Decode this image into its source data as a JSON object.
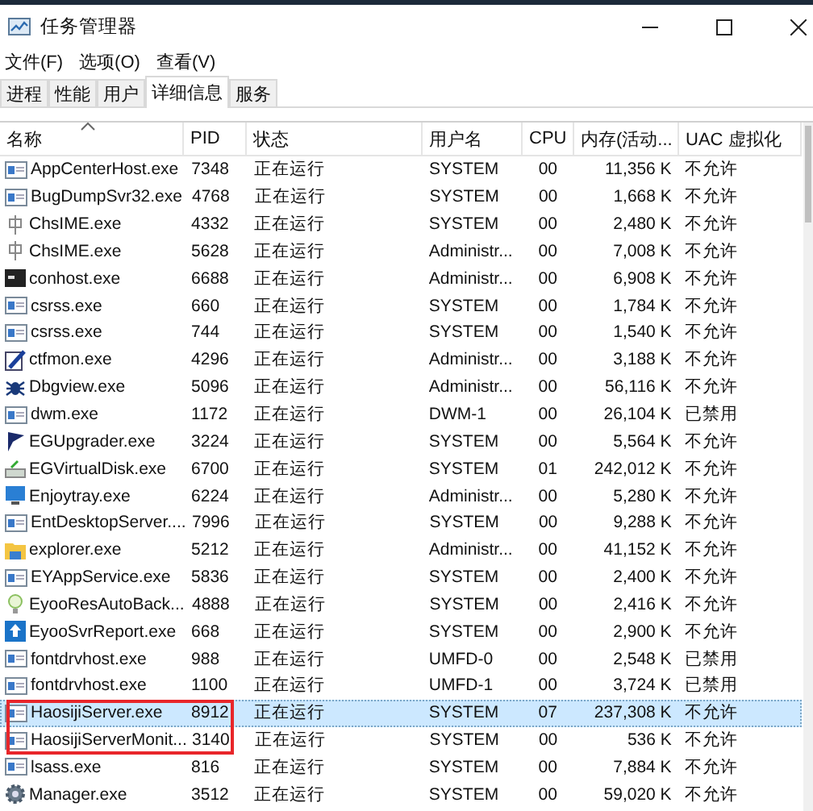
{
  "window": {
    "title": "任务管理器"
  },
  "menu": [
    "文件(F)",
    "选项(O)",
    "查看(V)"
  ],
  "tabs": [
    {
      "label": "进程",
      "selected": false
    },
    {
      "label": "性能",
      "selected": false
    },
    {
      "label": "用户",
      "selected": false
    },
    {
      "label": "详细信息",
      "selected": true
    },
    {
      "label": "服务",
      "selected": false
    }
  ],
  "table": {
    "columns": [
      {
        "label": "名称",
        "sorted": true
      },
      {
        "label": "PID"
      },
      {
        "label": "状态"
      },
      {
        "label": "用户名"
      },
      {
        "label": "CPU"
      },
      {
        "label": "内存(活动..."
      },
      {
        "label": "UAC 虚拟化"
      }
    ],
    "rows": [
      {
        "name": "AppCenterHost.exe",
        "pid": "7348",
        "status": "正在运行",
        "user": "SYSTEM",
        "cpu": "00",
        "memory": "11,356 K",
        "uac": "不允许",
        "selected": false,
        "boxed": false
      },
      {
        "name": "BugDumpSvr32.exe",
        "pid": "4768",
        "status": "正在运行",
        "user": "SYSTEM",
        "cpu": "00",
        "memory": "1,668 K",
        "uac": "不允许",
        "selected": false,
        "boxed": false
      },
      {
        "name": "ChsIME.exe",
        "pid": "4332",
        "status": "正在运行",
        "user": "SYSTEM",
        "cpu": "00",
        "memory": "2,480 K",
        "uac": "不允许",
        "selected": false,
        "boxed": false
      },
      {
        "name": "ChsIME.exe",
        "pid": "5628",
        "status": "正在运行",
        "user": "Administr...",
        "cpu": "00",
        "memory": "7,008 K",
        "uac": "不允许",
        "selected": false,
        "boxed": false
      },
      {
        "name": "conhost.exe",
        "pid": "6688",
        "status": "正在运行",
        "user": "Administr...",
        "cpu": "00",
        "memory": "6,908 K",
        "uac": "不允许",
        "selected": false,
        "boxed": false
      },
      {
        "name": "csrss.exe",
        "pid": "660",
        "status": "正在运行",
        "user": "SYSTEM",
        "cpu": "00",
        "memory": "1,784 K",
        "uac": "不允许",
        "selected": false,
        "boxed": false
      },
      {
        "name": "csrss.exe",
        "pid": "744",
        "status": "正在运行",
        "user": "SYSTEM",
        "cpu": "00",
        "memory": "1,540 K",
        "uac": "不允许",
        "selected": false,
        "boxed": false
      },
      {
        "name": "ctfmon.exe",
        "pid": "4296",
        "status": "正在运行",
        "user": "Administr...",
        "cpu": "00",
        "memory": "3,188 K",
        "uac": "不允许",
        "selected": false,
        "boxed": false
      },
      {
        "name": "Dbgview.exe",
        "pid": "5096",
        "status": "正在运行",
        "user": "Administr...",
        "cpu": "00",
        "memory": "56,116 K",
        "uac": "不允许",
        "selected": false,
        "boxed": false
      },
      {
        "name": "dwm.exe",
        "pid": "1172",
        "status": "正在运行",
        "user": "DWM-1",
        "cpu": "00",
        "memory": "26,104 K",
        "uac": "已禁用",
        "selected": false,
        "boxed": false
      },
      {
        "name": "EGUpgrader.exe",
        "pid": "3224",
        "status": "正在运行",
        "user": "SYSTEM",
        "cpu": "00",
        "memory": "5,564 K",
        "uac": "不允许",
        "selected": false,
        "boxed": false
      },
      {
        "name": "EGVirtualDisk.exe",
        "pid": "6700",
        "status": "正在运行",
        "user": "SYSTEM",
        "cpu": "01",
        "memory": "242,012 K",
        "uac": "不允许",
        "selected": false,
        "boxed": false
      },
      {
        "name": "Enjoytray.exe",
        "pid": "6224",
        "status": "正在运行",
        "user": "Administr...",
        "cpu": "00",
        "memory": "5,280 K",
        "uac": "不允许",
        "selected": false,
        "boxed": false
      },
      {
        "name": "EntDesktopServer....",
        "pid": "7996",
        "status": "正在运行",
        "user": "SYSTEM",
        "cpu": "00",
        "memory": "9,288 K",
        "uac": "不允许",
        "selected": false,
        "boxed": false
      },
      {
        "name": "explorer.exe",
        "pid": "5212",
        "status": "正在运行",
        "user": "Administr...",
        "cpu": "00",
        "memory": "41,152 K",
        "uac": "不允许",
        "selected": false,
        "boxed": false
      },
      {
        "name": "EYAppService.exe",
        "pid": "5836",
        "status": "正在运行",
        "user": "SYSTEM",
        "cpu": "00",
        "memory": "2,400 K",
        "uac": "不允许",
        "selected": false,
        "boxed": false
      },
      {
        "name": "EyooResAutoBack...",
        "pid": "4888",
        "status": "正在运行",
        "user": "SYSTEM",
        "cpu": "00",
        "memory": "2,416 K",
        "uac": "不允许",
        "selected": false,
        "boxed": false
      },
      {
        "name": "EyooSvrReport.exe",
        "pid": "668",
        "status": "正在运行",
        "user": "SYSTEM",
        "cpu": "00",
        "memory": "2,900 K",
        "uac": "不允许",
        "selected": false,
        "boxed": false
      },
      {
        "name": "fontdrvhost.exe",
        "pid": "988",
        "status": "正在运行",
        "user": "UMFD-0",
        "cpu": "00",
        "memory": "2,548 K",
        "uac": "已禁用",
        "selected": false,
        "boxed": false
      },
      {
        "name": "fontdrvhost.exe",
        "pid": "1100",
        "status": "正在运行",
        "user": "UMFD-1",
        "cpu": "00",
        "memory": "3,724 K",
        "uac": "已禁用",
        "selected": false,
        "boxed": false
      },
      {
        "name": "HaosijiServer.exe",
        "pid": "8912",
        "status": "正在运行",
        "user": "SYSTEM",
        "cpu": "07",
        "memory": "237,308 K",
        "uac": "不允许",
        "selected": true,
        "boxed": true
      },
      {
        "name": "HaosijiServerMonit...",
        "pid": "3140",
        "status": "正在运行",
        "user": "SYSTEM",
        "cpu": "00",
        "memory": "536 K",
        "uac": "不允许",
        "selected": false,
        "boxed": true
      },
      {
        "name": "lsass.exe",
        "pid": "816",
        "status": "正在运行",
        "user": "SYSTEM",
        "cpu": "00",
        "memory": "7,884 K",
        "uac": "不允许",
        "selected": false,
        "boxed": false
      },
      {
        "name": "Manager.exe",
        "pid": "3512",
        "status": "正在运行",
        "user": "SYSTEM",
        "cpu": "00",
        "memory": "59,020 K",
        "uac": "不允许",
        "selected": false,
        "boxed": false
      }
    ]
  }
}
